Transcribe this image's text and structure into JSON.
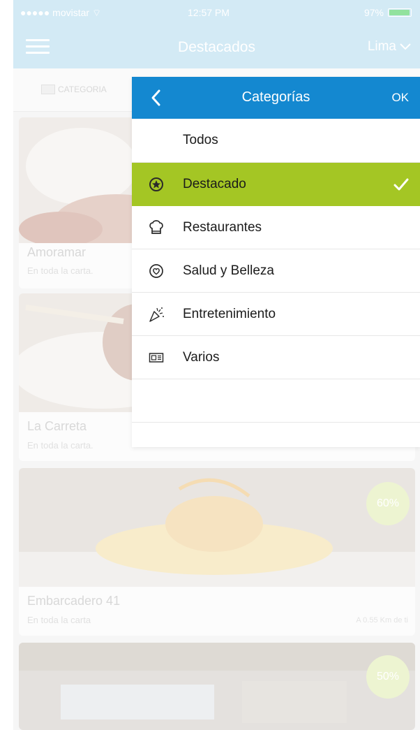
{
  "status_bar": {
    "carrier": "●●●●● movistar ⌔",
    "time": "12:57 PM",
    "battery": "97%"
  },
  "navbar": {
    "title": "Destacados",
    "city": "Lima"
  },
  "filter": {
    "category_label": "CATEGORIA"
  },
  "listings": [
    {
      "name": "Amoramar",
      "subtitle": "En toda la carta."
    },
    {
      "name": "La Carreta",
      "subtitle": "En toda la carta."
    },
    {
      "name": "Embarcadero 41",
      "subtitle": "En toda la carta",
      "distance": "A 0.55 Km de ti",
      "discount": "60%"
    },
    {
      "discount": "50%"
    }
  ],
  "categories_panel": {
    "title": "Categorías",
    "ok_label": "OK",
    "items": [
      {
        "label": "Todos",
        "icon": "none",
        "selected": false
      },
      {
        "label": "Destacado",
        "icon": "star-badge-icon",
        "selected": true
      },
      {
        "label": "Restaurantes",
        "icon": "chef-hat-icon",
        "selected": false
      },
      {
        "label": "Salud y Belleza",
        "icon": "heart-circle-icon",
        "selected": false
      },
      {
        "label": "Entretenimiento",
        "icon": "party-popper-icon",
        "selected": false
      },
      {
        "label": "Varios",
        "icon": "ticket-icon",
        "selected": false
      }
    ]
  },
  "colors": {
    "header_blue": "#1488d0",
    "selected_green": "#a4c624",
    "app_bar_faded": "#bcdff0"
  }
}
